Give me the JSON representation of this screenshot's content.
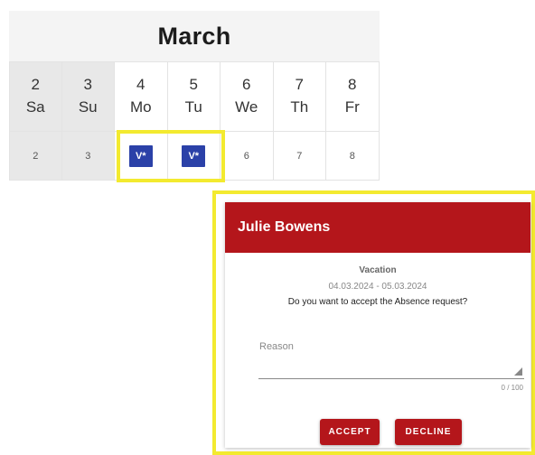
{
  "calendar": {
    "month": "March",
    "days": [
      {
        "num": "2",
        "name": "Sa",
        "cell": "2",
        "vacation": false,
        "weekend": true
      },
      {
        "num": "3",
        "name": "Su",
        "cell": "3",
        "vacation": false,
        "weekend": true
      },
      {
        "num": "4",
        "name": "Mo",
        "cell": "",
        "vacation": true,
        "weekend": false
      },
      {
        "num": "5",
        "name": "Tu",
        "cell": "",
        "vacation": true,
        "weekend": false
      },
      {
        "num": "6",
        "name": "We",
        "cell": "6",
        "vacation": false,
        "weekend": false
      },
      {
        "num": "7",
        "name": "Th",
        "cell": "7",
        "vacation": false,
        "weekend": false
      },
      {
        "num": "8",
        "name": "Fr",
        "cell": "8",
        "vacation": false,
        "weekend": false
      }
    ],
    "vacation_badge": "V*"
  },
  "dialog": {
    "title": "Julie Bowens",
    "leave_type": "Vacation",
    "date_range": "04.03.2024 - 05.03.2024",
    "question": "Do you want to accept the Absence request?",
    "reason_label": "Reason",
    "reason_value": "",
    "counter": "0 / 100",
    "accept_label": "ACCEPT",
    "decline_label": "DECLINE"
  },
  "colors": {
    "accent": "#b4161b",
    "vacation_badge": "#2b41a8",
    "highlight": "#f3ea2f",
    "weekend_bg": "#e8e8e8"
  }
}
